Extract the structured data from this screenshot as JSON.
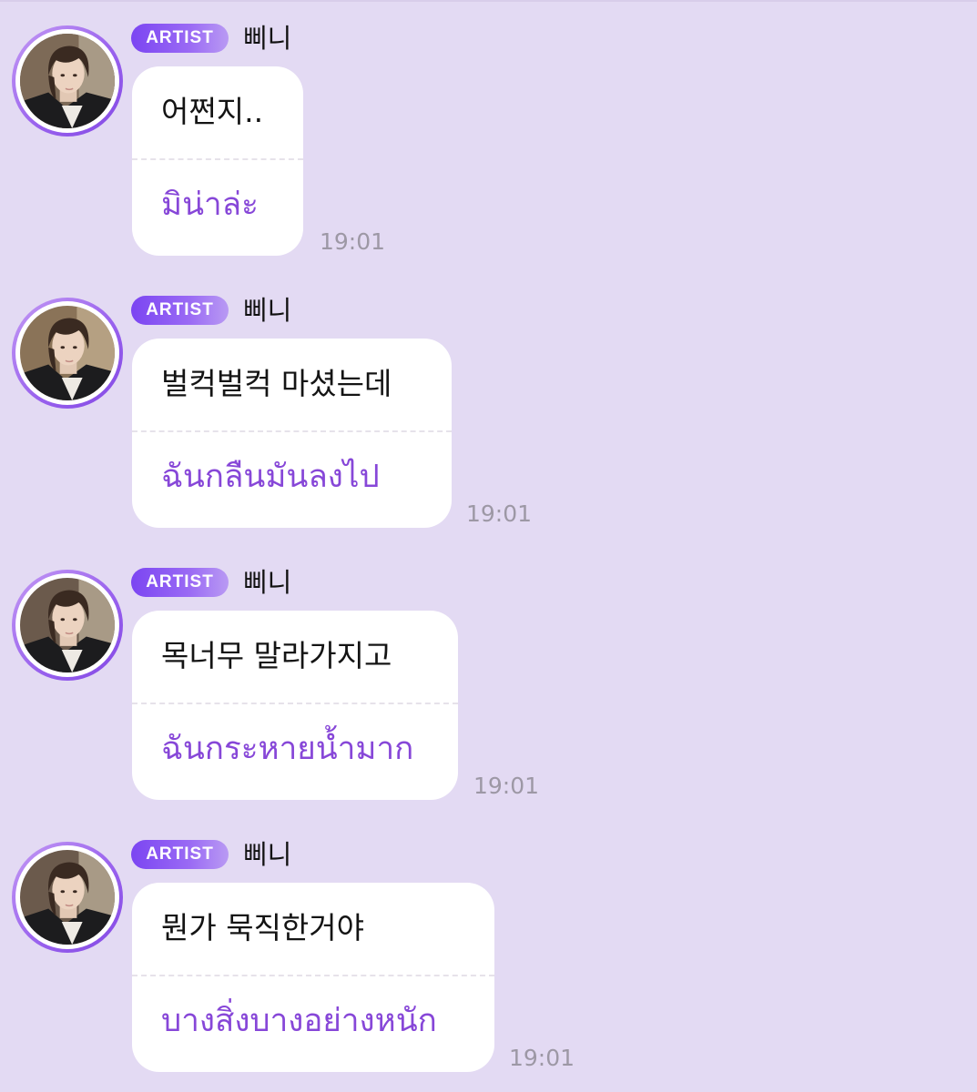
{
  "badge_label": "ARTIST",
  "sender_name": "삐니",
  "messages": [
    {
      "original": "어쩐지..",
      "translation": "มิน่าล่ะ",
      "time": "19:01"
    },
    {
      "original": "벌컥벌컥 마셨는데",
      "translation": "ฉันกลืนมันลงไป",
      "time": "19:01"
    },
    {
      "original": "목너무 말라가지고",
      "translation": "ฉันกระหายน้ำมาก",
      "time": "19:01"
    },
    {
      "original": "뭔가 묵직한거야",
      "translation": "บางสิ่งบางอย่างหนัก",
      "time": "19:01"
    }
  ],
  "colors": {
    "background": "#e3daf3",
    "badge": "#7b45f2",
    "translation": "#8747d8",
    "timestamp": "#9d98a5"
  }
}
